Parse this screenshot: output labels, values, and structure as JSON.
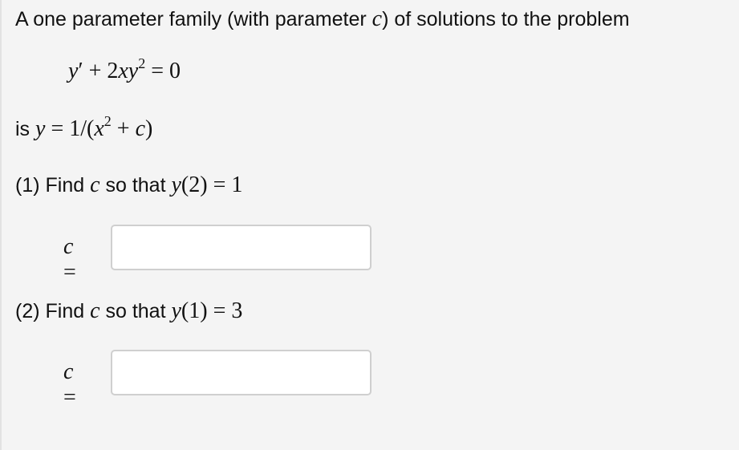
{
  "intro": {
    "text_before": "A one parameter family (with parameter ",
    "param": "c",
    "text_after": ") of solutions to the problem"
  },
  "equation": {
    "y": "y",
    "prime": "′",
    "plus": " + 2",
    "x": "x",
    "y2": "y",
    "exp": "2",
    "rest": " = 0"
  },
  "solution": {
    "prefix": "is ",
    "y": "y",
    "eq": " = 1/(",
    "x": "x",
    "exp": "2",
    "plus": " + ",
    "c": "c",
    "close": ")"
  },
  "questions": [
    {
      "number": "(1) Find ",
      "var": "c",
      "mid": " so that ",
      "y": "y",
      "cond": "(2) = 1",
      "label_var": "c",
      "label_eq": " =",
      "input_value": "",
      "input_placeholder": ""
    },
    {
      "number": "(2) Find ",
      "var": "c",
      "mid": " so that ",
      "y": "y",
      "cond": "(1) = 3",
      "label_var": "c",
      "label_eq": " =",
      "input_value": "",
      "input_placeholder": ""
    }
  ]
}
